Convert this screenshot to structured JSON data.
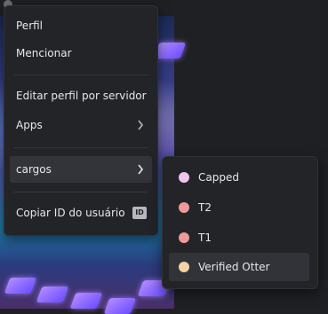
{
  "menu": {
    "items": [
      {
        "label": "Perfil"
      },
      {
        "label": "Mencionar"
      },
      {
        "label": "Editar perfil por servidor"
      },
      {
        "label": "Apps"
      },
      {
        "label": "cargos"
      },
      {
        "label": "Copiar ID do usuário"
      }
    ],
    "id_badge": "ID"
  },
  "roles": [
    {
      "name": "Capped",
      "color": "#f1c4ef"
    },
    {
      "name": "T2",
      "color": "#ef9a98"
    },
    {
      "name": "T1",
      "color": "#ef9a98"
    },
    {
      "name": "Verified Otter",
      "color": "#f4d2a6"
    }
  ],
  "icons": {
    "apps_chevron": "chevron-right-icon",
    "cargos_chevron": "chevron-right-icon"
  }
}
